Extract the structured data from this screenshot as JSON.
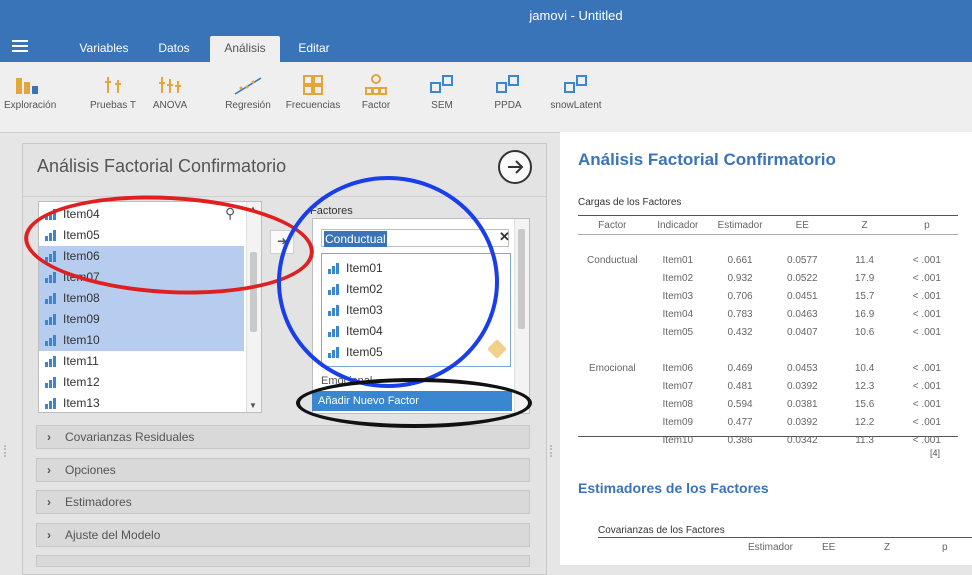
{
  "app_title": "jamovi - Untitled",
  "tabs": [
    {
      "label": "Variables"
    },
    {
      "label": "Datos"
    },
    {
      "label": "Análisis"
    },
    {
      "label": "Editar"
    }
  ],
  "ribbon": [
    {
      "label": "Exploración",
      "icon": "bar-chart-icon"
    },
    {
      "label": "Pruebas T",
      "icon": "t-tests-icon"
    },
    {
      "label": "ANOVA",
      "icon": "anova-icon"
    },
    {
      "label": "Regresión",
      "icon": "regression-icon"
    },
    {
      "label": "Frecuencias",
      "icon": "frequencies-icon"
    },
    {
      "label": "Factor",
      "icon": "factor-icon"
    },
    {
      "label": "SEM",
      "icon": "sem-module-icon"
    },
    {
      "label": "PPDA",
      "icon": "ppda-module-icon"
    },
    {
      "label": "snowLatent",
      "icon": "snowlatent-module-icon"
    }
  ],
  "panel": {
    "title": "Análisis Factorial Confirmatorio",
    "variables": [
      {
        "label": "Item04",
        "selected": false
      },
      {
        "label": "Item05",
        "selected": false
      },
      {
        "label": "Item06",
        "selected": true
      },
      {
        "label": "Item07",
        "selected": true
      },
      {
        "label": "Item08",
        "selected": true
      },
      {
        "label": "Item09",
        "selected": true
      },
      {
        "label": "Item10",
        "selected": true
      },
      {
        "label": "Item11",
        "selected": false
      },
      {
        "label": "Item12",
        "selected": false
      },
      {
        "label": "Item13",
        "selected": false
      }
    ],
    "factors_label": "Factores",
    "factor1_name": "Conductual",
    "factor1_items": [
      "Item01",
      "Item02",
      "Item03",
      "Item04",
      "Item05"
    ],
    "factor2_name": "Emocional",
    "add_factor_label": "Añadir Nuevo Factor",
    "sections": [
      "Covarianzas Residuales",
      "Opciones",
      "Estimadores",
      "Ajuste del Modelo"
    ]
  },
  "results": {
    "title": "Análisis Factorial Confirmatorio",
    "table_caption": "Cargas de los Factores",
    "columns": [
      "Factor",
      "Indicador",
      "Estimador",
      "EE",
      "Z",
      "p"
    ],
    "rows": [
      [
        "Conductual",
        "Item01",
        "0.661",
        "0.0577",
        "11.4",
        "< .001"
      ],
      [
        "",
        "Item02",
        "0.932",
        "0.0522",
        "17.9",
        "< .001"
      ],
      [
        "",
        "Item03",
        "0.706",
        "0.0451",
        "15.7",
        "< .001"
      ],
      [
        "",
        "Item04",
        "0.783",
        "0.0463",
        "16.9",
        "< .001"
      ],
      [
        "",
        "Item05",
        "0.432",
        "0.0407",
        "10.6",
        "< .001"
      ],
      [
        "Emocional",
        "Item06",
        "0.469",
        "0.0453",
        "10.4",
        "< .001"
      ],
      [
        "",
        "Item07",
        "0.481",
        "0.0392",
        "12.3",
        "< .001"
      ],
      [
        "",
        "Item08",
        "0.594",
        "0.0381",
        "15.6",
        "< .001"
      ],
      [
        "",
        "Item09",
        "0.477",
        "0.0392",
        "12.2",
        "< .001"
      ],
      [
        "",
        "Item10",
        "0.386",
        "0.0342",
        "11.3",
        "< .001"
      ]
    ],
    "table_note": "[4]",
    "subtitle": "Estimadores de los Factores",
    "table2_caption": "Covarianzas de los Factores",
    "table2_columns": [
      "Estimador",
      "EE",
      "Z",
      "p"
    ]
  },
  "colors": {
    "brand": "#3a74b8",
    "selection": "#b7cdef",
    "annotation_red": "#e02020",
    "annotation_blue": "#1a3ee8",
    "annotation_black": "#111111"
  }
}
